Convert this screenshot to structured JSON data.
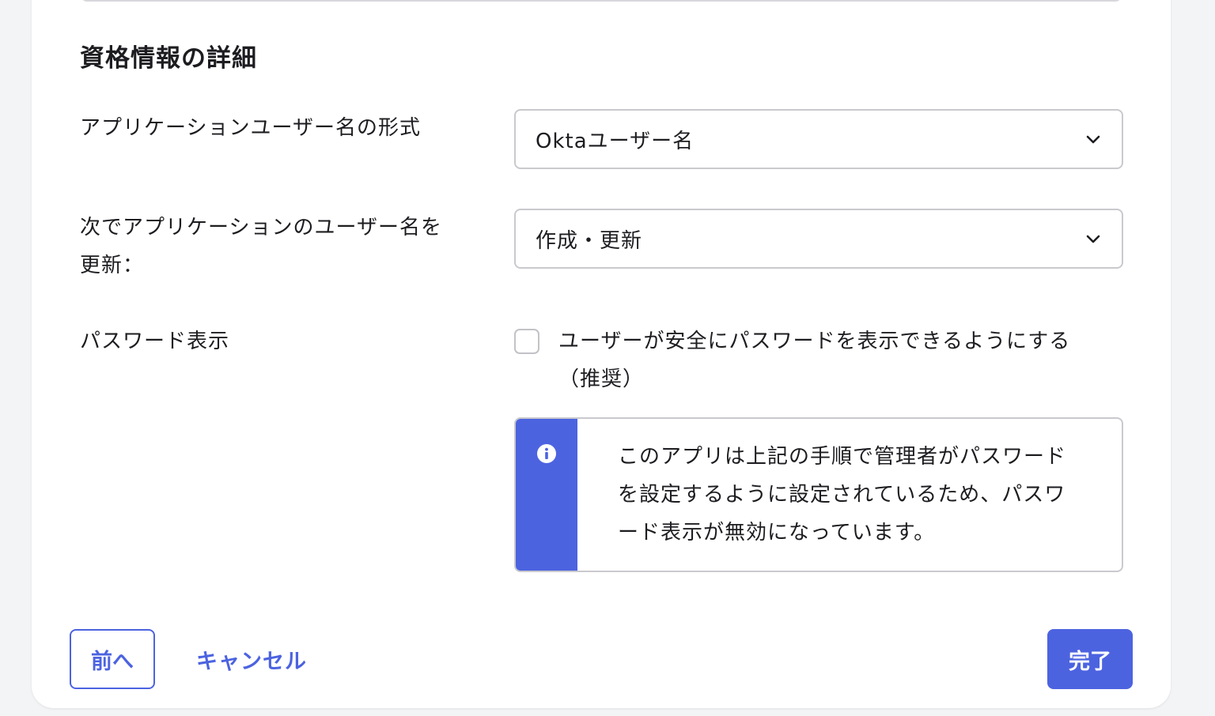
{
  "section": {
    "title": "資格情報の詳細"
  },
  "fields": {
    "username_format": {
      "label": "アプリケーションユーザー名の形式",
      "value": "Oktaユーザー名"
    },
    "update_username": {
      "label_line1": "次でアプリケーションのユーザー名を",
      "label_line2": "更新：",
      "value": "作成・更新"
    },
    "password_reveal": {
      "label": "パスワード表示",
      "checkbox_label_line1": "ユーザーが安全にパスワードを表示できるようにする",
      "checkbox_label_line2": "（推奨）",
      "checked": false
    }
  },
  "callout": {
    "icon": "info-icon",
    "line1": "このアプリは上記の手順で管理者がパスワード",
    "line2": "を設定するように設定されているため、パスワ",
    "line3": "ード表示が無効になっています。",
    "accent_color": "#4c63e0"
  },
  "buttons": {
    "prev_label": "前へ",
    "cancel_label": "キャンセル",
    "done_label": "完了"
  }
}
